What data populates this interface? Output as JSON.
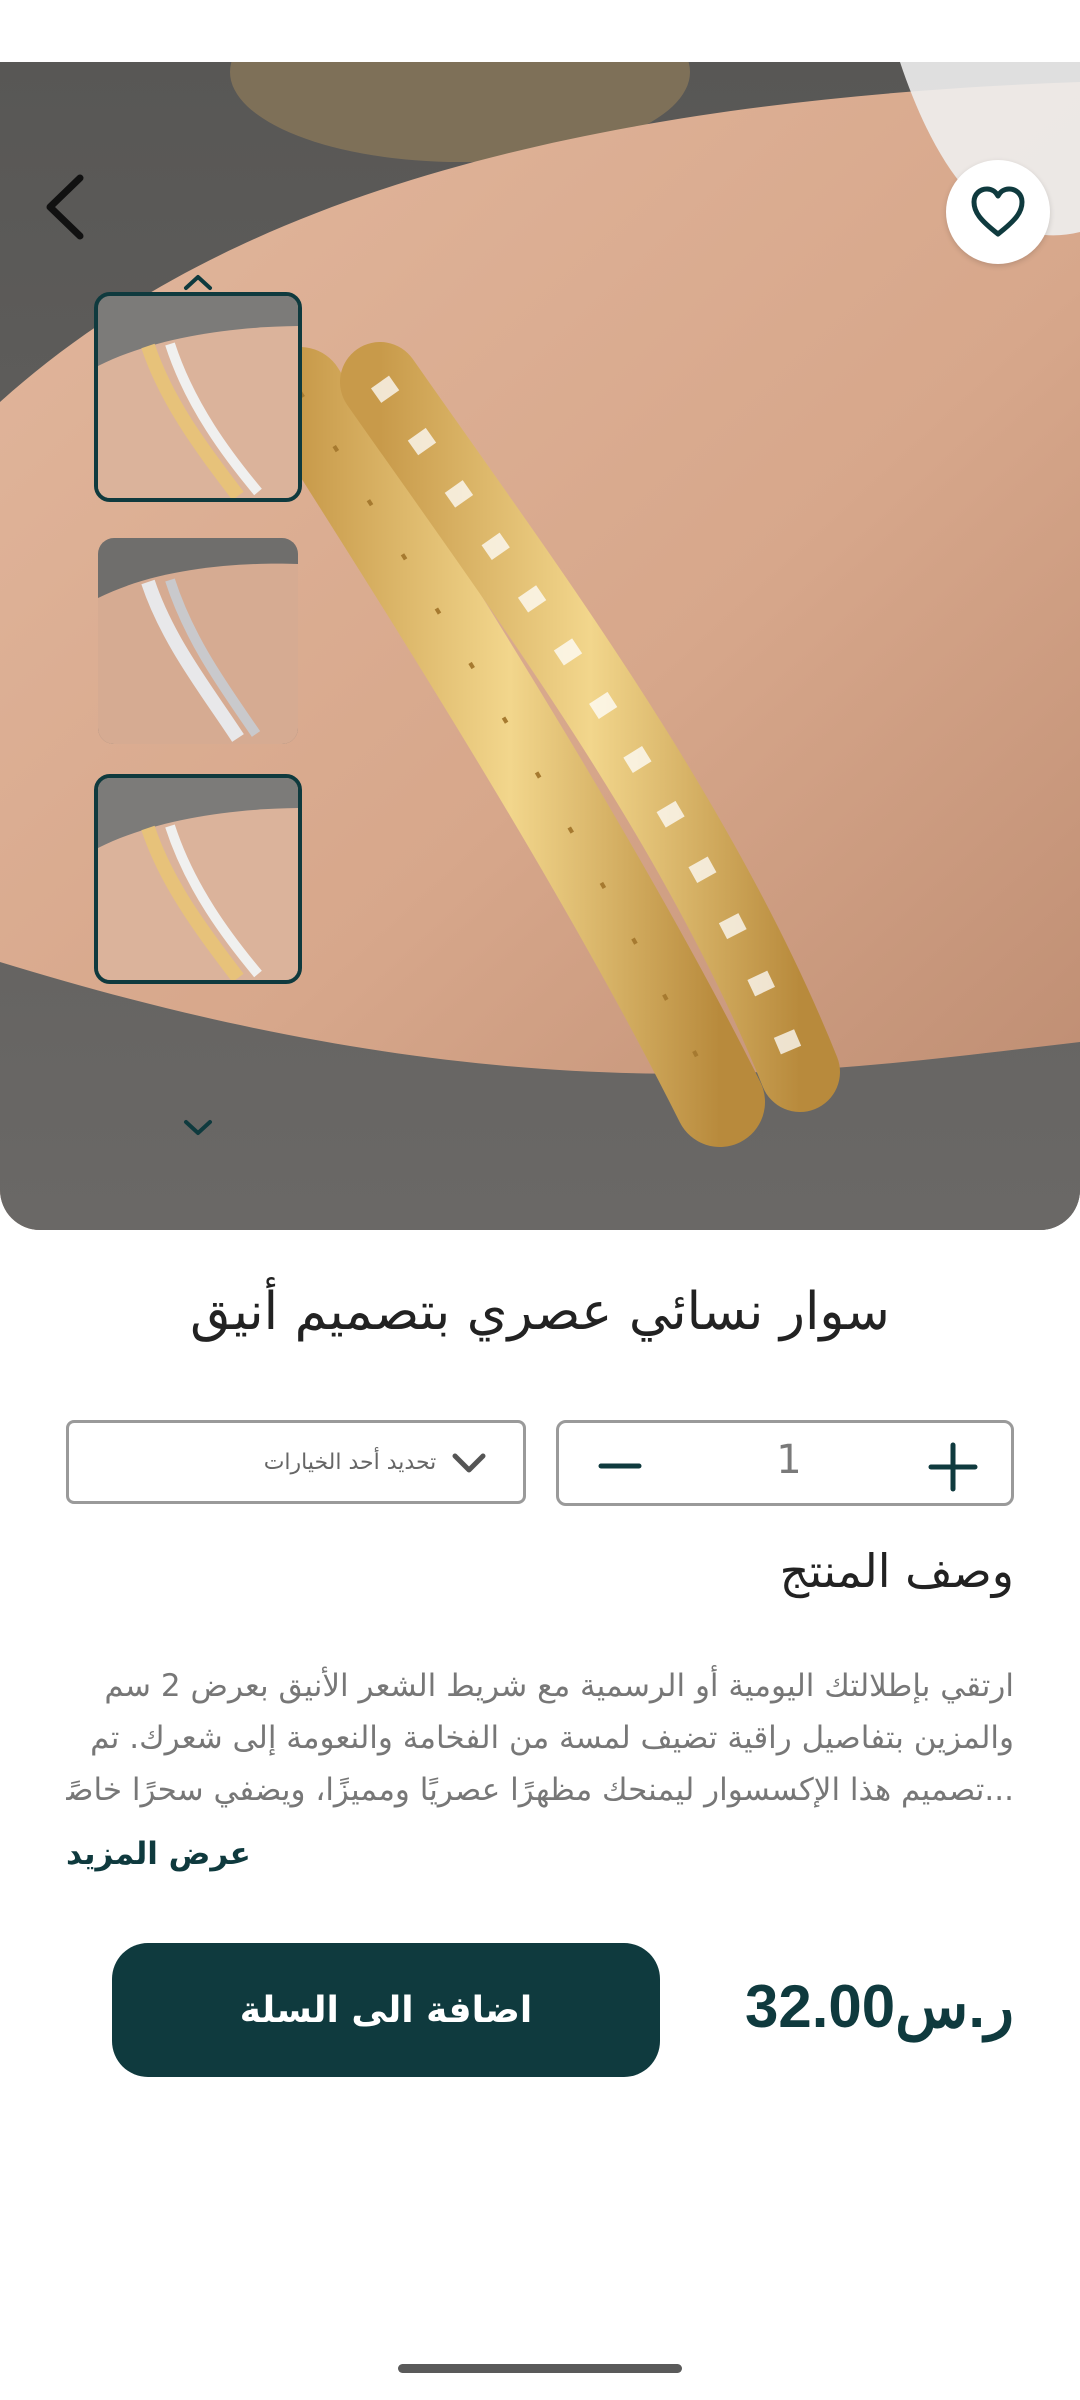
{
  "product": {
    "title": "سوار نسائي عصري بتصميم أنيق",
    "price": "32.00ر.س"
  },
  "gallery": {
    "thumbnail_count": 3,
    "selected_index": 2
  },
  "options": {
    "placeholder": "تحديد أحد الخيارات"
  },
  "quantity": {
    "value": "1"
  },
  "description": {
    "heading": "وصف المنتج",
    "lines": [
      "ارتقي بإطلالتك اليومية أو الرسمية مع شريط الشعر الأنيق بعرض 2 سم",
      "والمزين بتفاصيل راقية تضيف لمسة من الفخامة والنعومة إلى شعرك. تم",
      "...تصميم هذا الإكسسوار ليمنحك مظهرًا عصريًا ومميزًا، ويضفي سحرًا خاصًا"
    ],
    "show_more": "عرض المزيد"
  },
  "actions": {
    "add_to_cart": "اضافة الى السلة"
  },
  "icons": {
    "back": "back-arrow-icon",
    "favorite": "heart-icon",
    "scroll_up": "chevron-up-icon",
    "scroll_down": "chevron-down-icon",
    "dropdown": "chevron-down-icon",
    "decrement": "minus-icon",
    "increment": "plus-icon"
  },
  "colors": {
    "primary": "#0f3a3e",
    "text": "#222222",
    "muted": "#777777"
  }
}
